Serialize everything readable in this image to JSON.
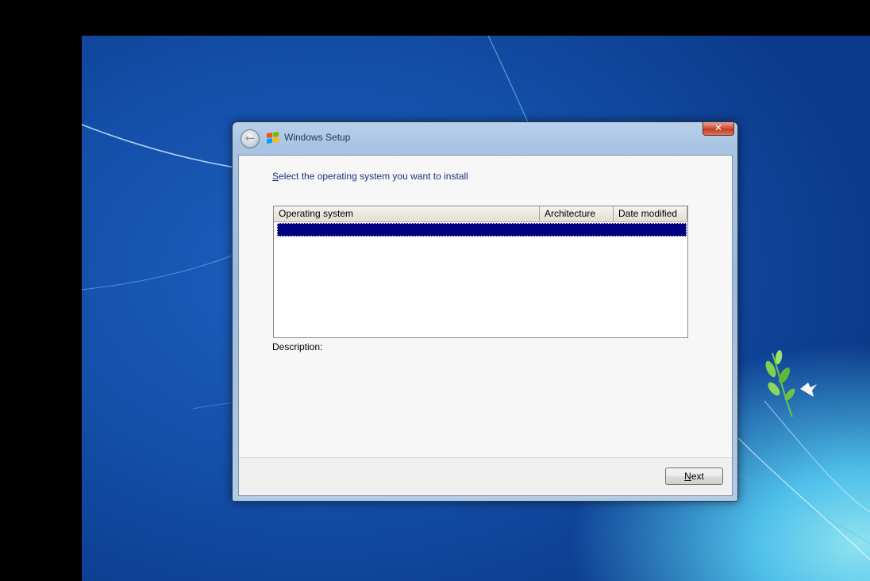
{
  "window": {
    "title": "Windows Setup",
    "close_glyph": "✕"
  },
  "page": {
    "heading_access_key": "S",
    "heading_rest": "elect the operating system you want to install",
    "description_label": "Description:"
  },
  "list": {
    "columns": [
      "Operating system",
      "Architecture",
      "Date modified"
    ],
    "rows": [
      {
        "selected": true,
        "os": "",
        "architecture": "",
        "date_modified": ""
      }
    ]
  },
  "footer": {
    "next_access_key": "N",
    "next_rest": "ext"
  },
  "icons": {
    "back": "back-arrow-icon",
    "logo": "windows-logo-icon",
    "close": "close-icon"
  },
  "colors": {
    "selection": "#000080",
    "heading_text": "#1e3287",
    "logo_red": "#f25022",
    "logo_green": "#7fba00",
    "logo_blue": "#00a4ef",
    "logo_yellow": "#ffb900"
  }
}
